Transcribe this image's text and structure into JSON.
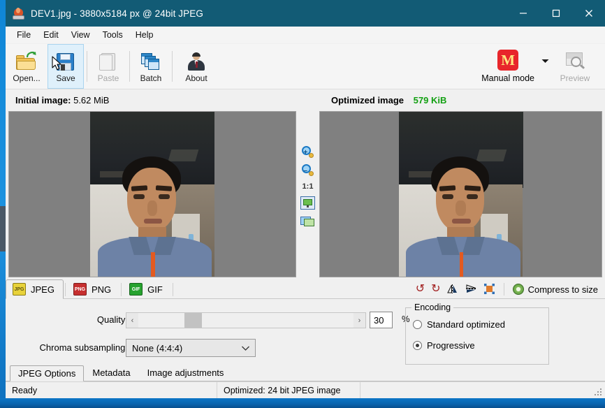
{
  "window": {
    "title": "DEV1.jpg - 3880x5184 px @ 24bit JPEG",
    "app_icon": "flame-icon",
    "minimize": "–",
    "maximize": "□",
    "close": "✕",
    "titlebar_color": "#125b75"
  },
  "menu": {
    "items": [
      {
        "label": "File"
      },
      {
        "label": "Edit"
      },
      {
        "label": "View"
      },
      {
        "label": "Tools"
      },
      {
        "label": "Help"
      }
    ]
  },
  "toolbar": {
    "open_label": "Open...",
    "save_label": "Save",
    "paste_label": "Paste",
    "batch_label": "Batch",
    "about_label": "About",
    "mode_letter": "M",
    "mode_label": "Manual mode",
    "mode_color": "#e8262b",
    "preview_label": "Preview"
  },
  "info": {
    "initial_label": "Initial image:",
    "initial_value": "5.62 MiB",
    "optimized_label": "Optimized image",
    "optimized_value": "579 KiB",
    "optimized_color": "#12a012"
  },
  "zoom_controls": {
    "zoom_in": "zoom-in-icon",
    "zoom_out": "zoom-out-icon",
    "actual_size": "1:1",
    "fit_window": "fit-to-window-icon",
    "compare": "compare-images-icon"
  },
  "format_tabs": [
    {
      "label": "JPEG",
      "icon": "JPG",
      "active": true
    },
    {
      "label": "PNG",
      "icon": "PNG",
      "active": false
    },
    {
      "label": "GIF",
      "icon": "GIF",
      "active": false
    }
  ],
  "image_tools": {
    "rotate_left": "↺",
    "rotate_right": "↻",
    "flip_horizontal": "◁|",
    "flip_vertical": "◺",
    "crop": "crop-icon",
    "compress_to_size": "Compress to size"
  },
  "options": {
    "quality_label": "Quality:",
    "quality_value": "30",
    "quality_percent": "%",
    "slider_left_arrow": "‹",
    "slider_right_arrow": "›",
    "chroma_label": "Chroma subsampling:",
    "chroma_value": "None (4:4:4)",
    "encoding_title": "Encoding",
    "encoding_options": [
      {
        "label": "Standard optimized",
        "selected": false
      },
      {
        "label": "Progressive",
        "selected": true
      }
    ]
  },
  "bottom_tabs": [
    {
      "label": "JPEG Options",
      "active": true
    },
    {
      "label": "Metadata",
      "active": false
    },
    {
      "label": "Image adjustments",
      "active": false
    }
  ],
  "status": {
    "left": "Ready",
    "middle": "Optimized: 24 bit JPEG image",
    "right": ""
  }
}
